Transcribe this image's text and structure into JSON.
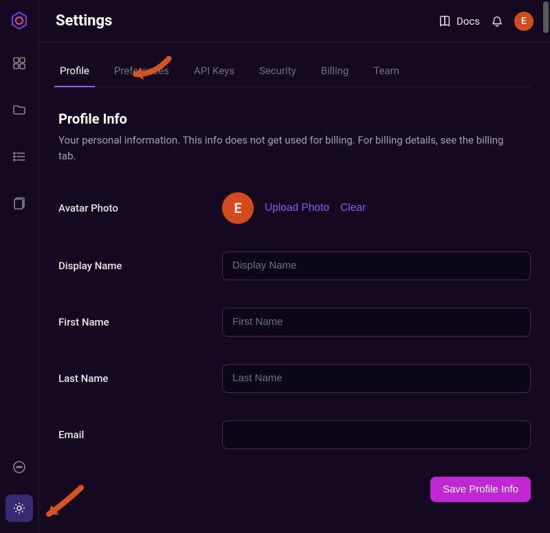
{
  "brand_accent": "#a855f7",
  "rail": {
    "items": [
      "dashboard",
      "folder",
      "list",
      "document"
    ],
    "bottom_items": [
      "chat",
      "settings"
    ]
  },
  "header": {
    "title": "Settings",
    "docs_label": "Docs",
    "avatar_initial": "E"
  },
  "tabs": [
    {
      "id": "profile",
      "label": "Profile",
      "active": true
    },
    {
      "id": "preferences",
      "label": "Preferences",
      "active": false
    },
    {
      "id": "apikeys",
      "label": "API Keys",
      "active": false
    },
    {
      "id": "security",
      "label": "Security",
      "active": false
    },
    {
      "id": "billing",
      "label": "Billing",
      "active": false
    },
    {
      "id": "team",
      "label": "Team",
      "active": false
    }
  ],
  "section": {
    "title": "Profile Info",
    "description": "Your personal information. This info does not get used for billing. For billing details, see the billing tab."
  },
  "avatar_field": {
    "label": "Avatar Photo",
    "initial": "E",
    "upload_label": "Upload Photo",
    "clear_label": "Clear"
  },
  "fields": {
    "display_name": {
      "label": "Display Name",
      "placeholder": "Display Name",
      "value": ""
    },
    "first_name": {
      "label": "First Name",
      "placeholder": "First Name",
      "value": ""
    },
    "last_name": {
      "label": "Last Name",
      "placeholder": "Last Name",
      "value": ""
    },
    "email": {
      "label": "Email",
      "placeholder": "",
      "value": ""
    }
  },
  "actions": {
    "save_label": "Save Profile Info"
  },
  "annotations": {
    "arrows": [
      {
        "points_to": "tab-profile",
        "color": "#d9531e"
      },
      {
        "points_to": "rail-settings",
        "color": "#d9531e"
      }
    ]
  }
}
